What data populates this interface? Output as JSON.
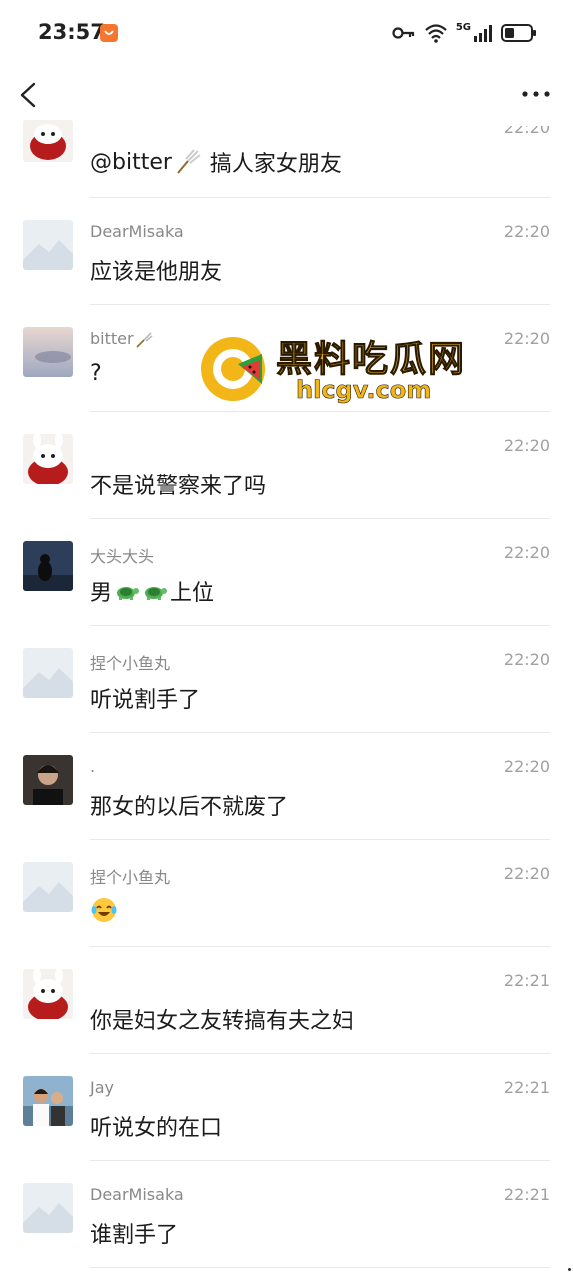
{
  "status_bar": {
    "time": "23:57",
    "network": "5G",
    "icons": [
      "app-notification-icon",
      "key-icon",
      "wifi-icon",
      "signal-icon",
      "battery-icon"
    ]
  },
  "nav": {
    "back_icon": "chevron-left-icon",
    "more_icon": "more-dots-icon"
  },
  "watermark": {
    "title": "黑料吃瓜网",
    "url": "hlcgv.com"
  },
  "comments": [
    {
      "name": "",
      "time": "22:20",
      "text": "@bitter",
      "text_after": "搞人家女朋友",
      "name_emoji": "",
      "avatar": "rabbit-avatar"
    },
    {
      "name": "DearMisaka",
      "time": "22:20",
      "text": "应该是他朋友",
      "avatar": "default-avatar"
    },
    {
      "name": "bitter",
      "time": "22:20",
      "text": "?",
      "avatar": "sky-avatar",
      "name_emoji": "badminton"
    },
    {
      "name": "",
      "time": "22:20",
      "text": "不是说警察来了吗",
      "avatar": "rabbit-avatar"
    },
    {
      "name": "大头大头",
      "time": "22:20",
      "text_before": "男",
      "text_after": "上位",
      "avatar": "night-avatar"
    },
    {
      "name": "捏个小鱼丸",
      "time": "22:20",
      "text": "听说割手了",
      "avatar": "default-avatar"
    },
    {
      "name": ".",
      "time": "22:20",
      "text": "那女的以后不就废了",
      "avatar": "person-avatar"
    },
    {
      "name": "捏个小鱼丸",
      "time": "22:20",
      "text": "",
      "avatar": "default-avatar",
      "emoji": "laughing-crying"
    },
    {
      "name": "",
      "time": "22:21",
      "text": "你是妇女之友转搞有夫之妇",
      "avatar": "rabbit-avatar"
    },
    {
      "name": "Jay",
      "time": "22:21",
      "text": "听说女的在口",
      "avatar": "couple-avatar"
    },
    {
      "name": "DearMisaka",
      "time": "22:21",
      "text": "谁割手了",
      "avatar": "default-avatar"
    }
  ],
  "colors": {
    "name": "#888888",
    "time": "#a0a0a0",
    "divider": "#e8e8e8",
    "watermark": "#f2b619"
  }
}
